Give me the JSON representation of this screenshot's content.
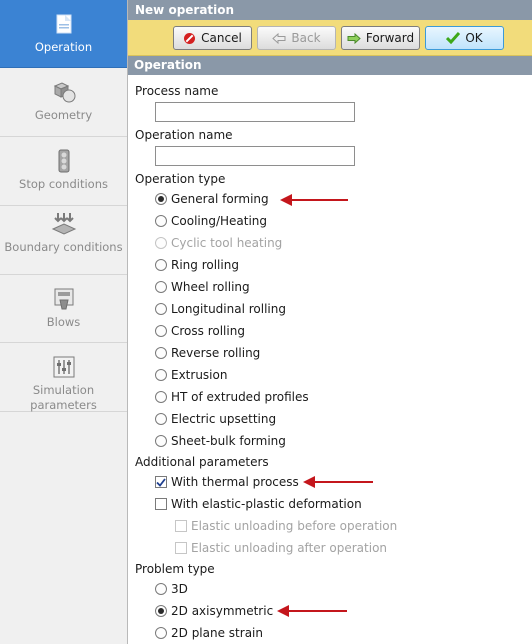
{
  "sidebar": {
    "items": [
      {
        "label": "Operation",
        "icon": "operation-icon",
        "active": true
      },
      {
        "label": "Geometry",
        "icon": "geometry-icon",
        "active": false
      },
      {
        "label": "Stop conditions",
        "icon": "traffic-light-icon",
        "active": false
      },
      {
        "label": "Boundary conditions",
        "icon": "boundary-conditions-icon",
        "active": false
      },
      {
        "label": "Blows",
        "icon": "blows-icon",
        "active": false
      },
      {
        "label": "Simulation parameters",
        "icon": "simulation-parameters-icon",
        "active": false
      }
    ]
  },
  "window": {
    "title": "New operation"
  },
  "toolbar": {
    "cancel_label": "Cancel",
    "back_label": "Back",
    "forward_label": "Forward",
    "ok_label": "OK"
  },
  "section": {
    "title": "Operation"
  },
  "form": {
    "process_name_label": "Process name",
    "process_name_value": "",
    "operation_name_label": "Operation name",
    "operation_name_value": "",
    "operation_type_label": "Operation type",
    "operation_types": [
      {
        "label": "General forming",
        "checked": true,
        "disabled": false
      },
      {
        "label": "Cooling/Heating",
        "checked": false,
        "disabled": false
      },
      {
        "label": "Cyclic tool heating",
        "checked": false,
        "disabled": true
      },
      {
        "label": "Ring rolling",
        "checked": false,
        "disabled": false
      },
      {
        "label": "Wheel rolling",
        "checked": false,
        "disabled": false
      },
      {
        "label": "Longitudinal rolling",
        "checked": false,
        "disabled": false
      },
      {
        "label": "Cross rolling",
        "checked": false,
        "disabled": false
      },
      {
        "label": "Reverse rolling",
        "checked": false,
        "disabled": false
      },
      {
        "label": "Extrusion",
        "checked": false,
        "disabled": false
      },
      {
        "label": "HT of extruded profiles",
        "checked": false,
        "disabled": false
      },
      {
        "label": "Electric upsetting",
        "checked": false,
        "disabled": false
      },
      {
        "label": "Sheet-bulk forming",
        "checked": false,
        "disabled": false
      }
    ],
    "additional_label": "Additional parameters",
    "additional": [
      {
        "label": "With thermal process",
        "checked": true,
        "disabled": false
      },
      {
        "label": "With elastic-plastic deformation",
        "checked": false,
        "disabled": false
      },
      {
        "label": "Elastic unloading before operation",
        "checked": false,
        "disabled": true
      },
      {
        "label": "Elastic unloading after operation",
        "checked": false,
        "disabled": true
      }
    ],
    "problem_type_label": "Problem type",
    "problem_types": [
      {
        "label": "3D",
        "checked": false,
        "disabled": false
      },
      {
        "label": "2D axisymmetric",
        "checked": true,
        "disabled": false
      },
      {
        "label": "2D plane strain",
        "checked": false,
        "disabled": false
      }
    ]
  },
  "colors": {
    "sidebar_active": "#3b83d3",
    "header_bar": "#8a98a8",
    "toolbar_bg": "#f2dc7b",
    "annotation_arrow": "#c4161c"
  }
}
